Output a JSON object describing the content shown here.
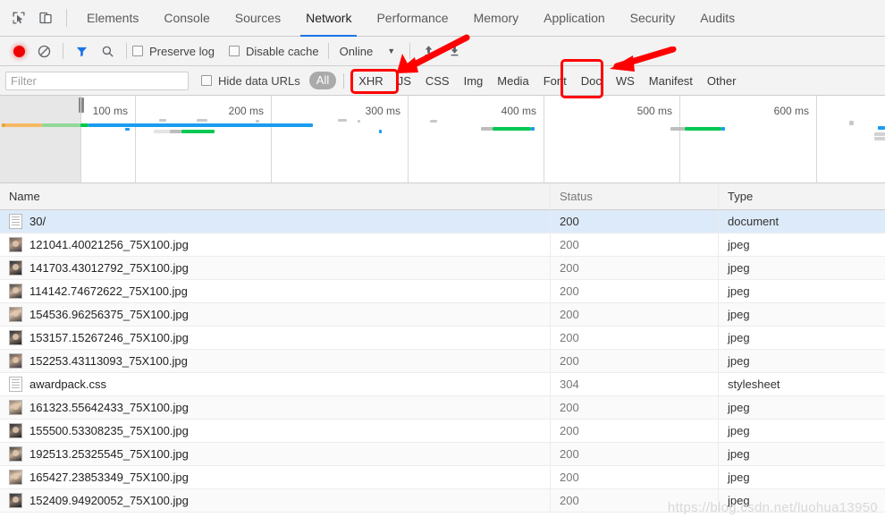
{
  "window": {
    "app": "Chrome DevTools"
  },
  "tabbar": {
    "inspect_icon": "inspect-element-icon",
    "device_icon": "device-toolbar-icon",
    "tabs": [
      {
        "label": "Elements",
        "active": false
      },
      {
        "label": "Console",
        "active": false
      },
      {
        "label": "Sources",
        "active": false
      },
      {
        "label": "Network",
        "active": true
      },
      {
        "label": "Performance",
        "active": false
      },
      {
        "label": "Memory",
        "active": false
      },
      {
        "label": "Application",
        "active": false
      },
      {
        "label": "Security",
        "active": false
      },
      {
        "label": "Audits",
        "active": false
      }
    ]
  },
  "action_bar": {
    "record_icon": "record-button",
    "clear_icon": "clear-icon",
    "filter_icon": "filter-funnel-icon",
    "search_icon": "search-icon",
    "preserve_log_label": "Preserve log",
    "disable_cache_label": "Disable cache",
    "throttling_value": "Online",
    "throttling_caret": "chevron-down-icon",
    "import_icon": "import-har-icon",
    "export_icon": "export-har-icon"
  },
  "filter_bar": {
    "filter_placeholder": "Filter",
    "filter_value": "",
    "hide_data_urls_label": "Hide data URLs",
    "types": [
      {
        "label": "All",
        "selected": true
      },
      {
        "label": "XHR",
        "selected": false
      },
      {
        "label": "JS",
        "selected": false
      },
      {
        "label": "CSS",
        "selected": false
      },
      {
        "label": "Img",
        "selected": false
      },
      {
        "label": "Media",
        "selected": false
      },
      {
        "label": "Font",
        "selected": false
      },
      {
        "label": "Doc",
        "selected": false
      },
      {
        "label": "WS",
        "selected": false
      },
      {
        "label": "Manifest",
        "selected": false
      },
      {
        "label": "Other",
        "selected": false
      }
    ]
  },
  "overview": {
    "time_labels": [
      "100 ms",
      "200 ms",
      "300 ms",
      "400 ms",
      "500 ms",
      "600 ms"
    ],
    "colors": {
      "wait": "#bdbdbd",
      "download": "#00c853",
      "transfer": "#1a9cf0",
      "dns": "#f0a030",
      "stalled": "#90d89a"
    }
  },
  "table": {
    "columns": [
      "Name",
      "Status",
      "Type"
    ],
    "rows": [
      {
        "name": "30/",
        "status": "200",
        "type": "document",
        "icon": "document-icon",
        "selected": true
      },
      {
        "name": "121041.40021256_75X100.jpg",
        "status": "200",
        "type": "jpeg",
        "icon": "image-thumb-icon",
        "selected": false
      },
      {
        "name": "141703.43012792_75X100.jpg",
        "status": "200",
        "type": "jpeg",
        "icon": "image-thumb-icon",
        "selected": false
      },
      {
        "name": "114142.74672622_75X100.jpg",
        "status": "200",
        "type": "jpeg",
        "icon": "image-thumb-icon",
        "selected": false
      },
      {
        "name": "154536.96256375_75X100.jpg",
        "status": "200",
        "type": "jpeg",
        "icon": "image-thumb-icon",
        "selected": false
      },
      {
        "name": "153157.15267246_75X100.jpg",
        "status": "200",
        "type": "jpeg",
        "icon": "image-thumb-icon",
        "selected": false
      },
      {
        "name": "152253.43113093_75X100.jpg",
        "status": "200",
        "type": "jpeg",
        "icon": "image-thumb-icon",
        "selected": false
      },
      {
        "name": "awardpack.css",
        "status": "304",
        "type": "stylesheet",
        "icon": "document-icon",
        "selected": false
      },
      {
        "name": "161323.55642433_75X100.jpg",
        "status": "200",
        "type": "jpeg",
        "icon": "image-thumb-icon",
        "selected": false
      },
      {
        "name": "155500.53308235_75X100.jpg",
        "status": "200",
        "type": "jpeg",
        "icon": "image-thumb-icon",
        "selected": false
      },
      {
        "name": "192513.25325545_75X100.jpg",
        "status": "200",
        "type": "jpeg",
        "icon": "image-thumb-icon",
        "selected": false
      },
      {
        "name": "165427.23853349_75X100.jpg",
        "status": "200",
        "type": "jpeg",
        "icon": "image-thumb-icon",
        "selected": false
      },
      {
        "name": "152409.94920052_75X100.jpg",
        "status": "200",
        "type": "jpeg",
        "icon": "image-thumb-icon",
        "selected": false
      }
    ]
  },
  "annotations": {
    "color": "#ff0000",
    "xhr_highlight": "XHR",
    "doc_highlight": "Doc",
    "arrow_count": 2
  },
  "watermark": {
    "text": "https://blog.csdn.net/luohua13950"
  }
}
